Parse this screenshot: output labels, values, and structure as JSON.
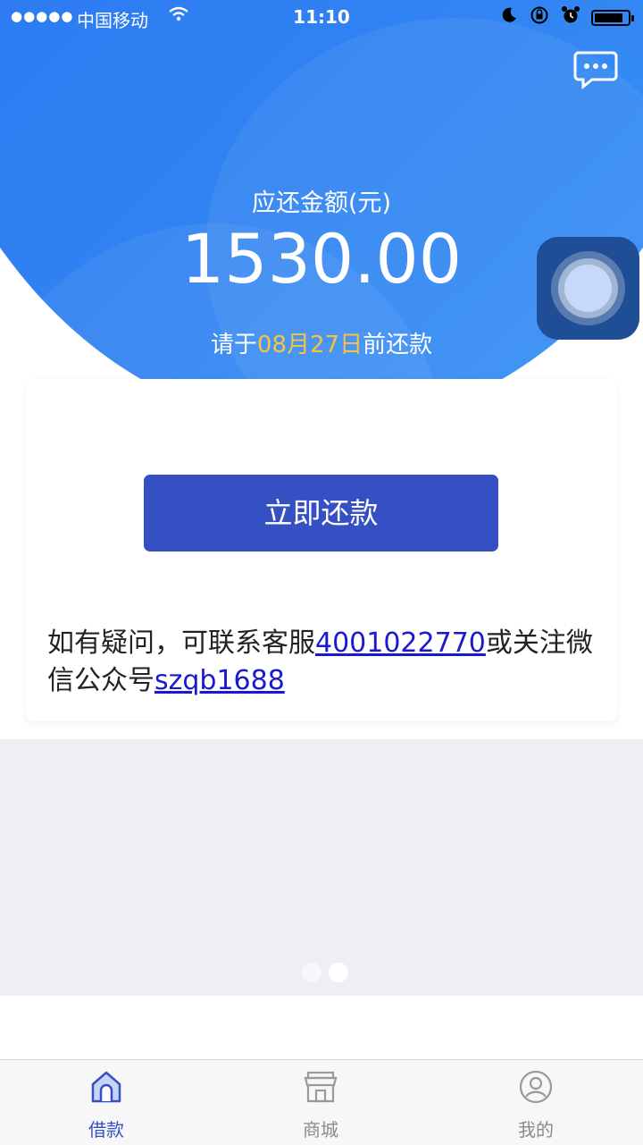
{
  "status_bar": {
    "signal": "●●●●●",
    "carrier": "中国移动",
    "time": "11:10",
    "battery_level": 0.85
  },
  "header": {
    "amount_label": "应还金额(元)",
    "amount": "1530.00",
    "due_prefix": "请于",
    "due_date": "08月27日",
    "due_suffix": "前还款"
  },
  "card": {
    "pay_button": "立即还款",
    "help_prefix": "如有疑问，可联系客服",
    "phone": "4001022770",
    "help_middle": "或关注微信公众号",
    "wechat": "szqb1688"
  },
  "tabs": [
    {
      "label": "借款",
      "icon": "home-icon",
      "active": true
    },
    {
      "label": "商城",
      "icon": "store-icon",
      "active": false
    },
    {
      "label": "我的",
      "icon": "user-icon",
      "active": false
    }
  ],
  "colors": {
    "brand_blue": "#3550c3",
    "hero_blue": "#2f80f2",
    "date_highlight": "#f5c342",
    "link": "#1919d2"
  }
}
